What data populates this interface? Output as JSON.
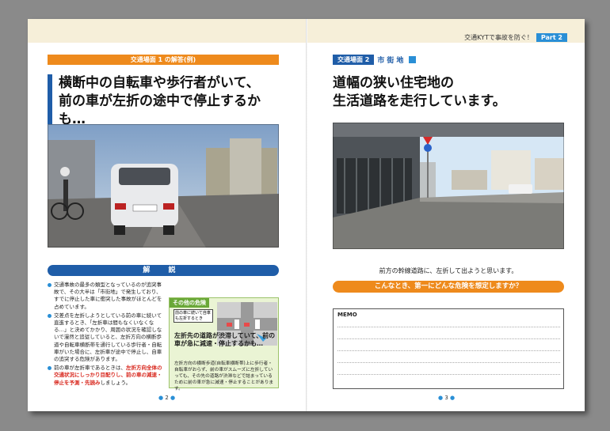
{
  "header": {
    "title": "交通KYTで事故を防ぐ！",
    "part": "Part 2"
  },
  "left_page": {
    "scene_label": "交通場面 1 の解答(例)",
    "headline": [
      "横断中の自転車や歩行者がいて、",
      "前の車が左折の途中で停止するかも…"
    ],
    "photo": "dashcam-street-car-ahead",
    "section_title": "解 説",
    "bullets": [
      "交通事故の最多の類型となっているのが追突事故で、その大半は「市街地」で発生しており、すでに停止した車に衝突した事故がほとんどを占めています。",
      "交差点を左折しようとしている前の車に続いて直進するとき、「左折車は間もなくいなくなる…」と決めてかかり、周囲の状況を確認しないで漫然と追従していると、左折方向の横断歩道や自転車横断帯を通行している歩行者・自転車がいた場合に、左折車が途中で停止し、自車の追突する危険があります。",
      "前の車が左折車であるときは、"
    ],
    "bullet_red": "左折方向全体の交通状況にしっかり目配りし、前の車の減速・停止を予測・先読み",
    "bullet_tail": "しましょう。",
    "danger": {
      "label": "その他の危険",
      "diagram_note": "前の車に続いて自車も左折するとき",
      "title": "左折先の道路が渋滞していて、前の車が急に減速・停止するかも…",
      "desc": "左折方向の横断歩道(自転車横断帯)上に歩行者・自転車がおらず、前の車がスムーズに左折していっても、その先の道路が渋滞などで詰まっているために前の車が急に減速・停止することがあります。"
    },
    "page_number": "2"
  },
  "right_page": {
    "scene_label": "交通場面 2",
    "scene_tag": "市街地",
    "headline": [
      "道幅の狭い住宅地の",
      "生活道路を走行しています。"
    ],
    "photo": "dashcam-narrow-residential-road",
    "caption": "前方の幹線道路に、左折して出ようと思います。",
    "question": "こんなとき、第一にどんな危険を想定しますか？",
    "memo_label": "MEMO",
    "page_number": "3"
  },
  "colors": {
    "accent_blue": "#1f5da8",
    "accent_orange": "#ee8a1c",
    "header_band": "#f6efd9",
    "danger_green": "#6aa838"
  }
}
